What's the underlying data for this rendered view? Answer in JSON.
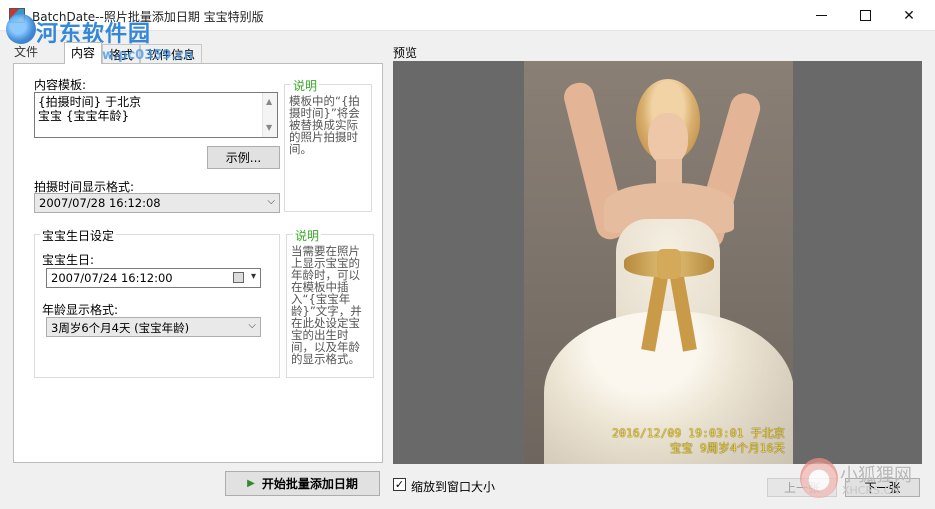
{
  "window": {
    "title": "BatchDate--照片批量添加日期 宝宝特别版"
  },
  "watermark": {
    "name": "河东软件园",
    "url": "www.pc0359.cn"
  },
  "menu": {
    "file": "文件"
  },
  "tabs": [
    {
      "label": "内容"
    },
    {
      "label": "格式"
    },
    {
      "label": "软件信息"
    }
  ],
  "content": {
    "template_label": "内容模板:",
    "template_line1": "{拍摄时间} 于北京",
    "template_line2": "宝宝 {宝宝年龄}",
    "note1_title": "说明",
    "note1_text": "模板中的“{拍摄时间}”将会被替换成实际的照片拍摄时间。",
    "example_button": "示例...",
    "shot_format_label": "拍摄时间显示格式:",
    "shot_format_value": "2007/07/28 16:12:08"
  },
  "baby": {
    "group_title": "宝宝生日设定",
    "birthday_label": "宝宝生日:",
    "birthday_value": "2007/07/24 16:12:00",
    "age_format_label": "年龄显示格式:",
    "age_format_value": "3周岁6个月4天 (宝宝年龄)",
    "note2_title": "说明",
    "note2_text": "当需要在照片上显示宝宝的年龄时，可以在模板中插入“{宝宝年龄}”文字，并在此处设定宝宝的出生时间，以及年龄的显示格式。"
  },
  "preview": {
    "label": "预览",
    "stamp_line1": "2016/12/09 19:03:01 于北京",
    "stamp_line2": "宝宝 9周岁4个月16天"
  },
  "footer": {
    "start_button": "开始批量添加日期",
    "fit_checkbox": "缩放到窗口大小",
    "fit_checked": "✓",
    "prev_button": "上一张",
    "next_button": "下一张"
  },
  "overlay": {
    "site_name": "小狐狸网",
    "site_url": "XHCRS.CN"
  }
}
